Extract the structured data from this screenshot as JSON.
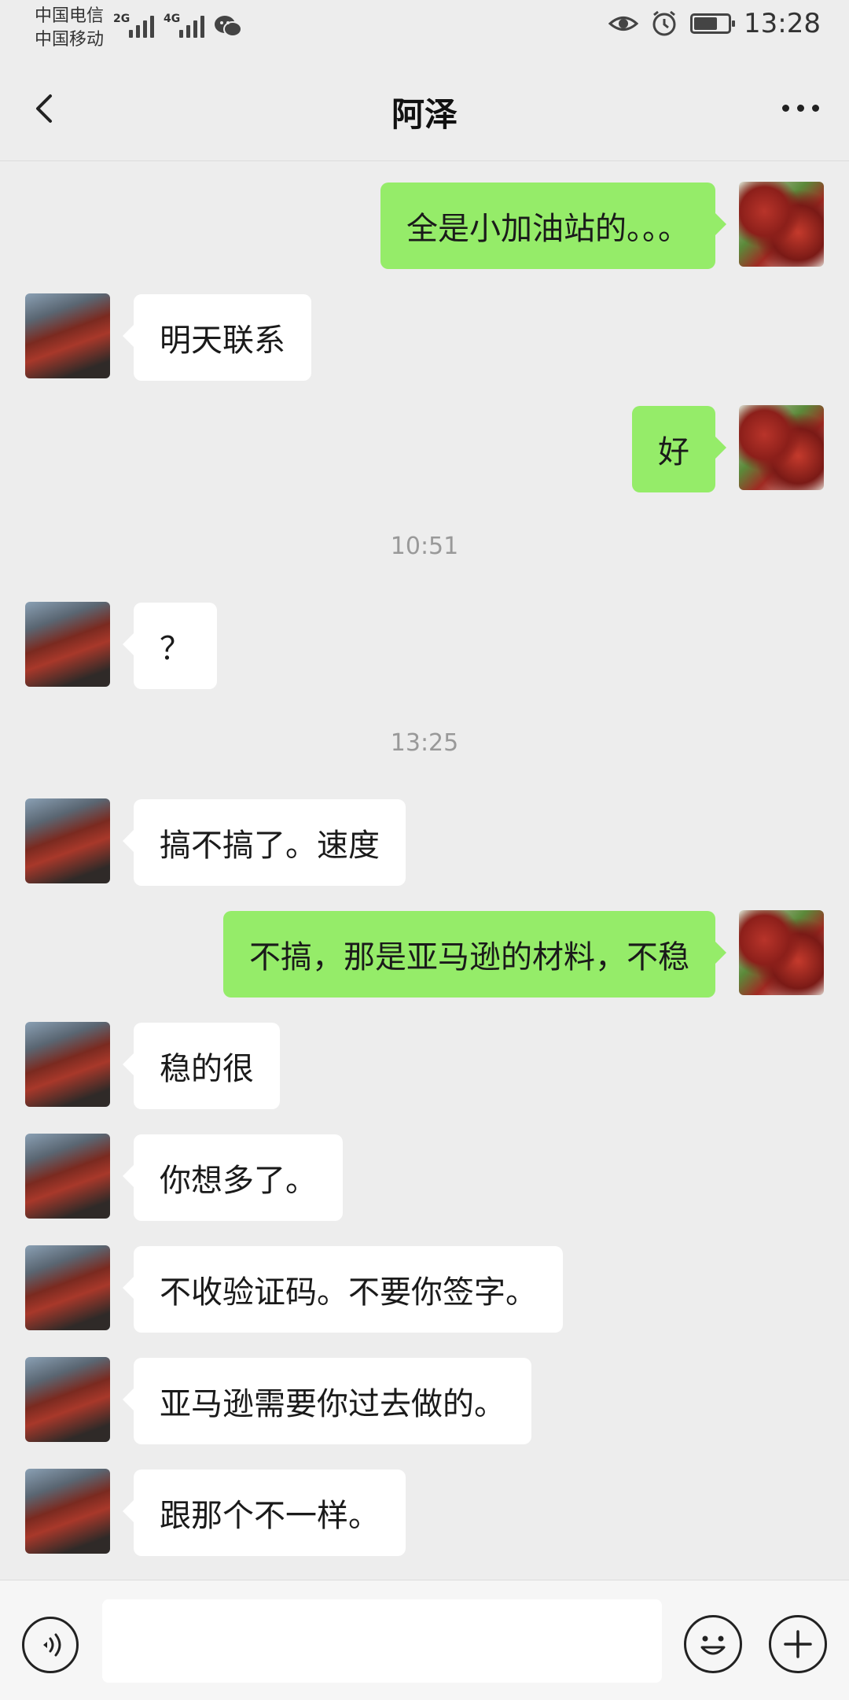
{
  "status_bar": {
    "carrier1": "中国电信",
    "carrier2": "中国移动",
    "net1": "2G",
    "net2": "4G",
    "time": "13:28",
    "battery_level": 0.7,
    "icons": [
      "signal-icon",
      "wechat-icon",
      "eye-icon",
      "alarm-icon",
      "battery-icon"
    ]
  },
  "header": {
    "title": "阿泽"
  },
  "messages": [
    {
      "from": "me",
      "text": "全是小加油站的。。。"
    },
    {
      "from": "friend",
      "text": "明天联系"
    },
    {
      "from": "me",
      "text": "好"
    },
    {
      "type": "time",
      "text": "10:51"
    },
    {
      "from": "friend",
      "text": "？"
    },
    {
      "type": "time",
      "text": "13:25"
    },
    {
      "from": "friend",
      "text": "搞不搞了。速度"
    },
    {
      "from": "me",
      "text": "不搞，那是亚马逊的材料，不稳"
    },
    {
      "from": "friend",
      "text": "稳的很"
    },
    {
      "from": "friend",
      "text": "你想多了。"
    },
    {
      "from": "friend",
      "text": "不收验证码。不要你签字。"
    },
    {
      "from": "friend",
      "text": "亚马逊需要你过去做的。"
    },
    {
      "from": "friend",
      "text": "跟那个不一样。"
    }
  ],
  "input": {
    "value": "",
    "placeholder": ""
  },
  "colors": {
    "background": "#ededed",
    "outgoing_bubble": "#95ec69",
    "incoming_bubble": "#ffffff"
  }
}
